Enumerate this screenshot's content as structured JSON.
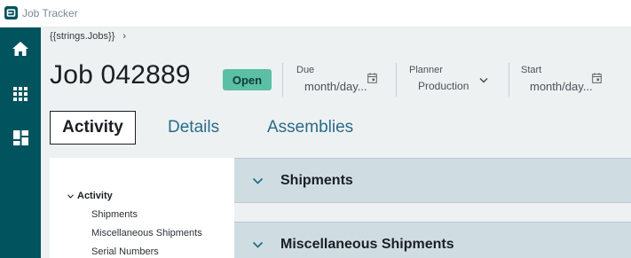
{
  "app": {
    "title": "Job Tracker",
    "logo_icon": "app-logo-icon"
  },
  "sidenav": [
    {
      "icon": "home-icon"
    },
    {
      "icon": "apps-grid-icon"
    },
    {
      "icon": "dashboard-icon"
    }
  ],
  "breadcrumb": {
    "root": "{{strings.Jobs}}",
    "separator": "›"
  },
  "job": {
    "title": "Job 042889",
    "status": "Open"
  },
  "fields": {
    "due": {
      "label": "Due",
      "value": "month/day..."
    },
    "planner": {
      "label": "Planner",
      "value": "Production"
    },
    "start": {
      "label": "Start",
      "value": "month/day..."
    }
  },
  "tabs": [
    {
      "label": "Activity",
      "active": true
    },
    {
      "label": "Details",
      "active": false
    },
    {
      "label": "Assemblies",
      "active": false
    }
  ],
  "tree": {
    "root": "Activity",
    "items": [
      "Shipments",
      "Miscellaneous Shipments",
      "Serial Numbers"
    ]
  },
  "panels": [
    {
      "title": "Shipments"
    },
    {
      "title": "Miscellaneous Shipments"
    }
  ],
  "colors": {
    "nav": "#01535e",
    "badge": "#5bbfa5",
    "panel": "#cfdde2",
    "tab_text": "#2a6b8a"
  }
}
